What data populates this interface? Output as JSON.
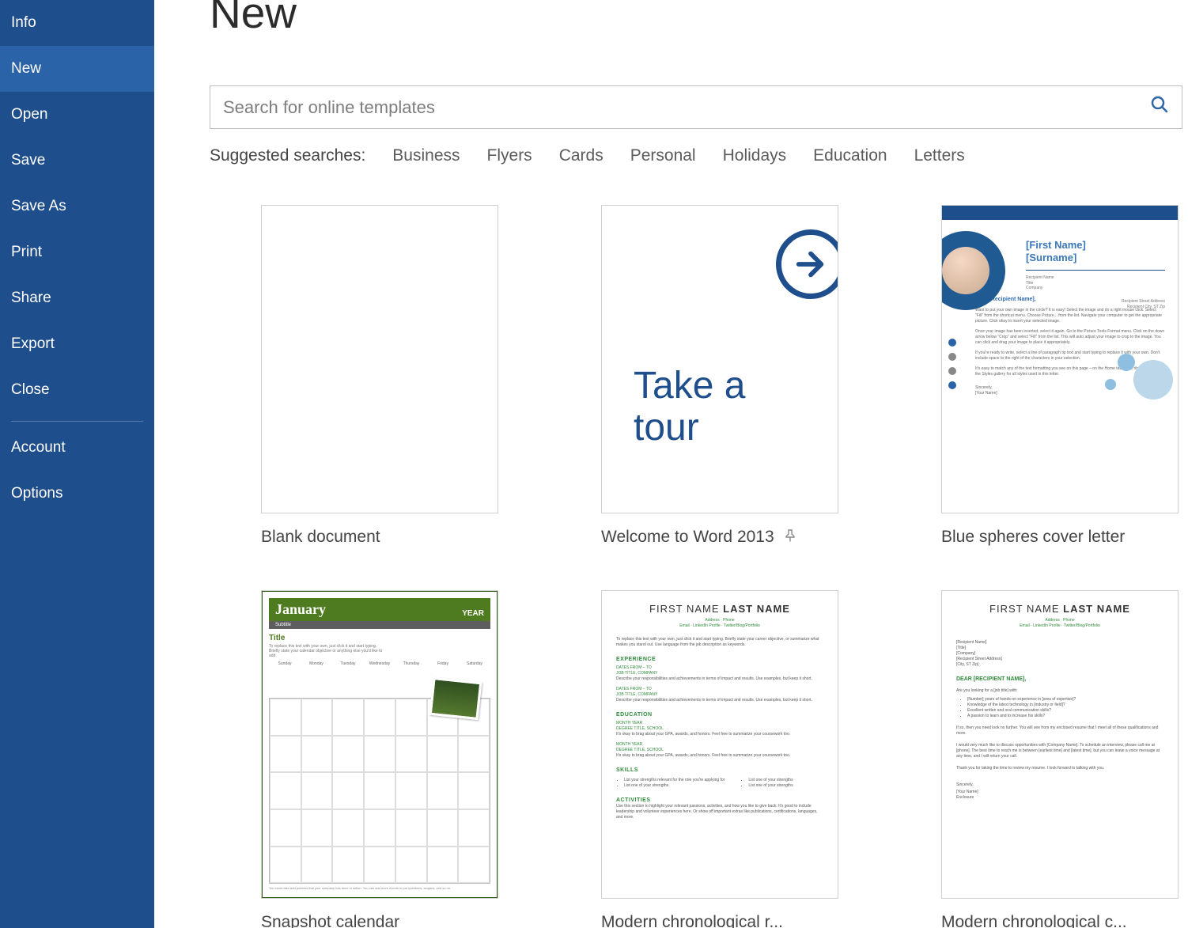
{
  "sidebar": {
    "items": [
      {
        "label": "Info",
        "selected": false
      },
      {
        "label": "New",
        "selected": true
      },
      {
        "label": "Open",
        "selected": false
      },
      {
        "label": "Save",
        "selected": false
      },
      {
        "label": "Save As",
        "selected": false
      },
      {
        "label": "Print",
        "selected": false
      },
      {
        "label": "Share",
        "selected": false
      },
      {
        "label": "Export",
        "selected": false
      },
      {
        "label": "Close",
        "selected": false
      }
    ],
    "bottom_items": [
      {
        "label": "Account"
      },
      {
        "label": "Options"
      }
    ]
  },
  "page_title": "New",
  "search": {
    "placeholder": "Search for online templates"
  },
  "suggested_label": "Suggested searches:",
  "suggested": [
    "Business",
    "Flyers",
    "Cards",
    "Personal",
    "Holidays",
    "Education",
    "Letters"
  ],
  "templates": [
    {
      "label": "Blank document",
      "pinned": false
    },
    {
      "label": "Welcome to Word 2013",
      "pinned": true,
      "tour_line1": "Take a",
      "tour_line2": "tour"
    },
    {
      "label": "Blue spheres cover letter",
      "pinned": false,
      "bs": {
        "first": "[First Name]",
        "last": "[Surname]",
        "sal": "Dear [Recipient Name],"
      }
    },
    {
      "label": "Snapshot calendar",
      "pinned": false,
      "cal": {
        "month": "January",
        "year": "YEAR",
        "title": "Title"
      }
    },
    {
      "label": "Modern chronological r...",
      "pinned": false,
      "res": {
        "first": "FIRST NAME",
        "last": "LAST NAME",
        "sec_exp": "EXPERIENCE",
        "sec_edu": "EDUCATION",
        "sec_skills": "SKILLS",
        "sec_act": "ACTIVITIES"
      }
    },
    {
      "label": "Modern chronological c...",
      "pinned": false,
      "cl": {
        "first": "FIRST NAME",
        "last": "LAST NAME",
        "sal": "DEAR [RECIPIENT NAME],",
        "sig": "Sincerely,"
      }
    }
  ]
}
